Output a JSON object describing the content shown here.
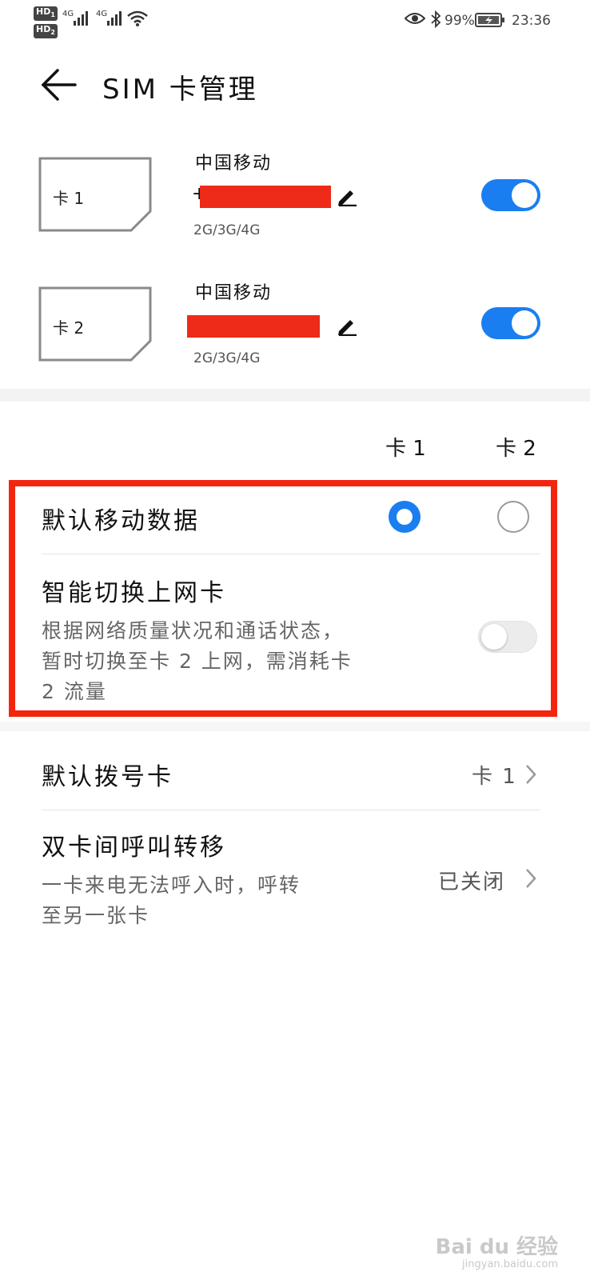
{
  "status_bar": {
    "hd1": "HD",
    "hd1_sub": "1",
    "hd2": "HD",
    "hd2_sub": "2",
    "network1": "4G",
    "network2": "4G",
    "battery": "99%",
    "time": "23:36",
    "icons": [
      "eye-icon",
      "bluetooth-icon",
      "battery-charging-icon",
      "wifi-icon",
      "signal-icon"
    ]
  },
  "header": {
    "title": "SIM 卡管理",
    "back_icon": "arrow-left-icon"
  },
  "sims": [
    {
      "card_label": "卡 1",
      "operator": "中国移动",
      "number_prefix": "+",
      "network": "2G/3G/4G",
      "enabled": true
    },
    {
      "card_label": "卡 2",
      "operator": "中国移动",
      "number_prefix": "",
      "network": "2G/3G/4G",
      "enabled": true
    }
  ],
  "columns": {
    "card1": "卡 1",
    "card2": "卡 2"
  },
  "default_data": {
    "label": "默认移动数据",
    "selected": "卡 1"
  },
  "smart_switch": {
    "label": "智能切换上网卡",
    "desc_line1": "根据网络质量状况和通话状态，",
    "desc_line2": "暂时切换至卡 2 上网，需消耗卡",
    "desc_line3": "2 流量",
    "enabled": false
  },
  "default_dial": {
    "label": "默认拨号卡",
    "value": "卡 1"
  },
  "call_forward": {
    "label": "双卡间呼叫转移",
    "desc_line1": "一卡来电无法呼入时，呼转",
    "desc_line2": "至另一张卡",
    "value": "已关闭"
  },
  "watermark": {
    "text": "Bai du 经验",
    "sub": "jingyan.baidu.com"
  },
  "colors": {
    "accent": "#1a7ef0",
    "highlight": "#f2260f",
    "redaction": "#ee2a18"
  }
}
